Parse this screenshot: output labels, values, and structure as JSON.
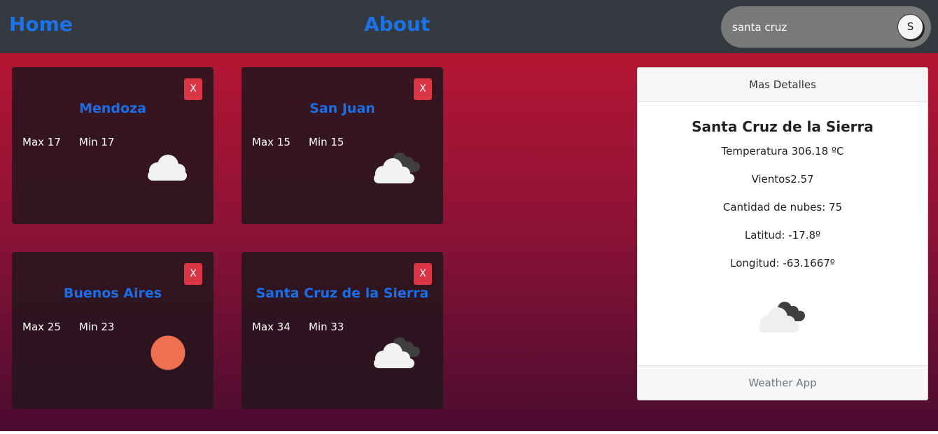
{
  "nav": {
    "home": "Home",
    "about": "About",
    "search_value": "santa cruz",
    "search_button": "S"
  },
  "cards": [
    {
      "city": "Mendoza",
      "max": "Max 17",
      "min": "Min 17",
      "close": "X",
      "icon": "cloud-icon"
    },
    {
      "city": "San Juan",
      "max": "Max 15",
      "min": "Min 15",
      "close": "X",
      "icon": "broken-clouds-icon"
    },
    {
      "city": "Buenos Aires",
      "max": "Max 25",
      "min": "Min 23",
      "close": "X",
      "icon": "sun-icon"
    },
    {
      "city": "Santa Cruz de la Sierra",
      "max": "Max 34",
      "min": "Min 33",
      "close": "X",
      "icon": "broken-clouds-icon"
    }
  ],
  "detail": {
    "header": "Mas Detalles",
    "city": "Santa Cruz de la Sierra",
    "temperature": "Temperatura 306.18 ºC",
    "wind": "Vientos2.57",
    "clouds": "Cantidad de nubes: 75",
    "latitude": "Latitud: -17.8º",
    "longitude": "Longitud: -63.1667º",
    "icon": "broken-clouds-icon",
    "footer": "Weather App"
  },
  "colors": {
    "navbar": "#343a40",
    "link": "#1a73e8",
    "close_button": "#dc3545",
    "sun": "#ee7050",
    "gradient_top": "#b41633",
    "gradient_bottom": "#4a0c30"
  }
}
